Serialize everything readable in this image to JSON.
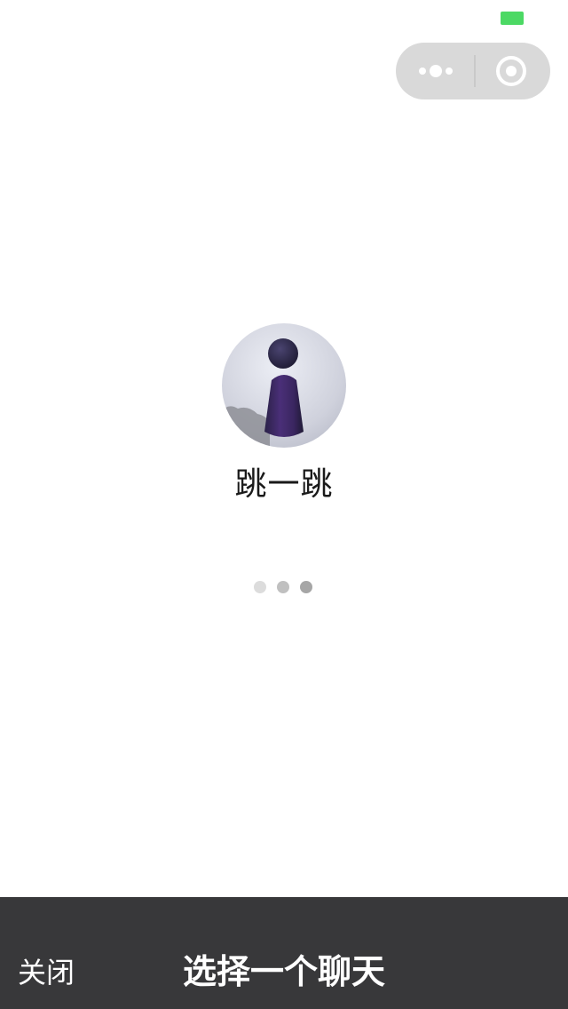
{
  "status_bar": {
    "battery_icon": "battery-icon",
    "battery_color": "#4cd964"
  },
  "capsule": {
    "more_icon": "more-dots-icon",
    "close_icon": "miniprogram-close-icon",
    "background": "#d9d9d9"
  },
  "app": {
    "name": "跳一跳",
    "logo_icon": "jump-game-logo"
  },
  "loading": {
    "icon": "loading-dots-icon",
    "dot_colors": [
      "#dcdcdc",
      "#c0c0c0",
      "#a6a6a6"
    ]
  },
  "share_bar": {
    "close_label": "关闭",
    "title": "选择一个聊天",
    "background": "#38383a"
  }
}
